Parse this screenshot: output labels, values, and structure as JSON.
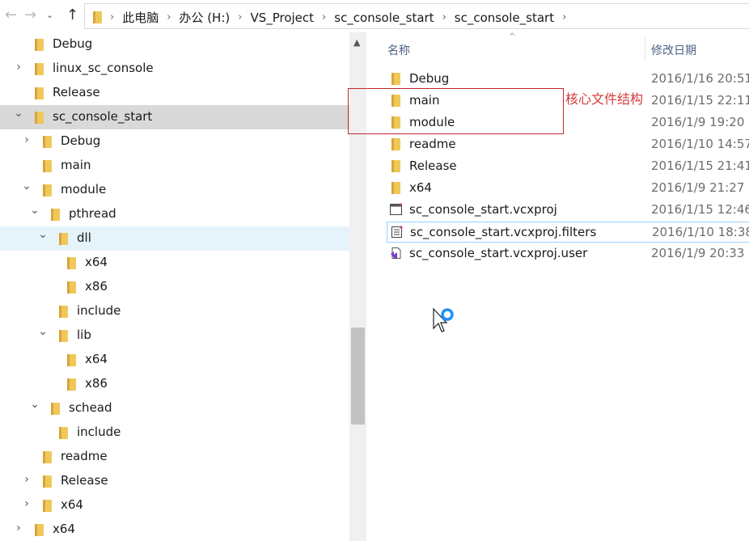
{
  "address_bar": {
    "breadcrumbs": [
      "此电脑",
      "办公 (H:)",
      "VS_Project",
      "sc_console_start",
      "sc_console_start"
    ]
  },
  "nav_tree": [
    {
      "label": "Debug",
      "depth": 0,
      "expander": "none"
    },
    {
      "label": "linux_sc_console",
      "depth": 0,
      "expander": "collapsed"
    },
    {
      "label": "Release",
      "depth": 0,
      "expander": "none"
    },
    {
      "label": "sc_console_start",
      "depth": 0,
      "expander": "expanded",
      "state": "selected"
    },
    {
      "label": "Debug",
      "depth": 1,
      "expander": "collapsed"
    },
    {
      "label": "main",
      "depth": 1,
      "expander": "none"
    },
    {
      "label": "module",
      "depth": 1,
      "expander": "expanded"
    },
    {
      "label": "pthread",
      "depth": 2,
      "expander": "expanded"
    },
    {
      "label": "dll",
      "depth": 3,
      "expander": "expanded",
      "state": "hover"
    },
    {
      "label": "x64",
      "depth": 4,
      "expander": "none"
    },
    {
      "label": "x86",
      "depth": 4,
      "expander": "none"
    },
    {
      "label": "include",
      "depth": 3,
      "expander": "none"
    },
    {
      "label": "lib",
      "depth": 3,
      "expander": "expanded"
    },
    {
      "label": "x64",
      "depth": 4,
      "expander": "none"
    },
    {
      "label": "x86",
      "depth": 4,
      "expander": "none"
    },
    {
      "label": "schead",
      "depth": 2,
      "expander": "expanded"
    },
    {
      "label": "include",
      "depth": 3,
      "expander": "none"
    },
    {
      "label": "readme",
      "depth": 1,
      "expander": "none"
    },
    {
      "label": "Release",
      "depth": 1,
      "expander": "collapsed"
    },
    {
      "label": "x64",
      "depth": 1,
      "expander": "collapsed"
    },
    {
      "label": "x64",
      "depth": 0,
      "expander": "collapsed"
    }
  ],
  "file_list": {
    "columns": {
      "name": "名称",
      "date": "修改日期"
    },
    "rows": [
      {
        "name": "Debug",
        "date": "2016/1/16 20:51",
        "type": "folder"
      },
      {
        "name": "main",
        "date": "2016/1/15 22:11",
        "type": "folder"
      },
      {
        "name": "module",
        "date": "2016/1/9 19:20",
        "type": "folder"
      },
      {
        "name": "readme",
        "date": "2016/1/10 14:57",
        "type": "folder"
      },
      {
        "name": "Release",
        "date": "2016/1/15 21:41",
        "type": "folder"
      },
      {
        "name": "x64",
        "date": "2016/1/9 21:27",
        "type": "folder"
      },
      {
        "name": "sc_console_start.vcxproj",
        "date": "2016/1/15 12:46",
        "type": "vcxproj"
      },
      {
        "name": "sc_console_start.vcxproj.filters",
        "date": "2016/1/10 18:38",
        "type": "filters",
        "state": "focused"
      },
      {
        "name": "sc_console_start.vcxproj.user",
        "date": "2016/1/9 20:33",
        "type": "user"
      }
    ]
  },
  "annotation": {
    "text": "核心文件结构",
    "color": "#c0292e"
  },
  "colors": {
    "folder": "#f0c85a",
    "selected_row": "#d9d9d9",
    "hover_row": "#e5f3fb",
    "header_text": "#4d6185"
  }
}
